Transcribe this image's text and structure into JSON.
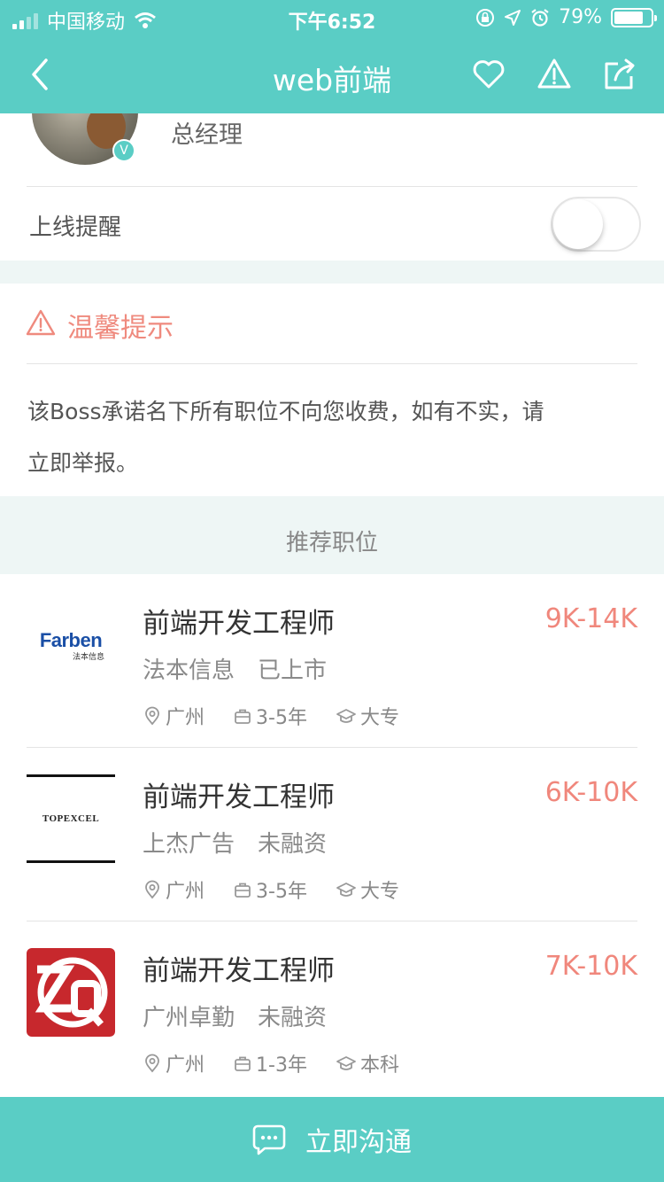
{
  "status_bar": {
    "carrier": "中国移动",
    "time": "下午6:52",
    "battery_percent": "79%",
    "battery_level": 0.79
  },
  "nav": {
    "title": "web前端"
  },
  "profile": {
    "job_title": "总经理",
    "verified_badge": "V",
    "online_reminder_label": "上线提醒",
    "online_reminder_on": false
  },
  "tip": {
    "title": "温馨提示",
    "line1": "该Boss承诺名下所有职位不向您收费，如有不实，请",
    "line2": "立即举报。"
  },
  "recommended": {
    "header": "推荐职位",
    "jobs": [
      {
        "title": "前端开发工程师",
        "salary": "9K-14K",
        "company": "法本信息　已上市",
        "location": "广州",
        "experience": "3-5年",
        "education": "大专",
        "logo_text": "Farben",
        "logo_subtext": "法本信息"
      },
      {
        "title": "前端开发工程师",
        "salary": "6K-10K",
        "company": "上杰广告　未融资",
        "location": "广州",
        "experience": "3-5年",
        "education": "大专",
        "logo_text": "TOPEXCEL"
      },
      {
        "title": "前端开发工程师",
        "salary": "7K-10K",
        "company": "广州卓勤　未融资",
        "location": "广州",
        "experience": "1-3年",
        "education": "本科",
        "logo_text": "ZQ"
      }
    ]
  },
  "bottom_bar": {
    "label": "立即沟通"
  },
  "colors": {
    "accent": "#5acdc5",
    "salary": "#f0877c",
    "tip": "#ef8a7e"
  }
}
